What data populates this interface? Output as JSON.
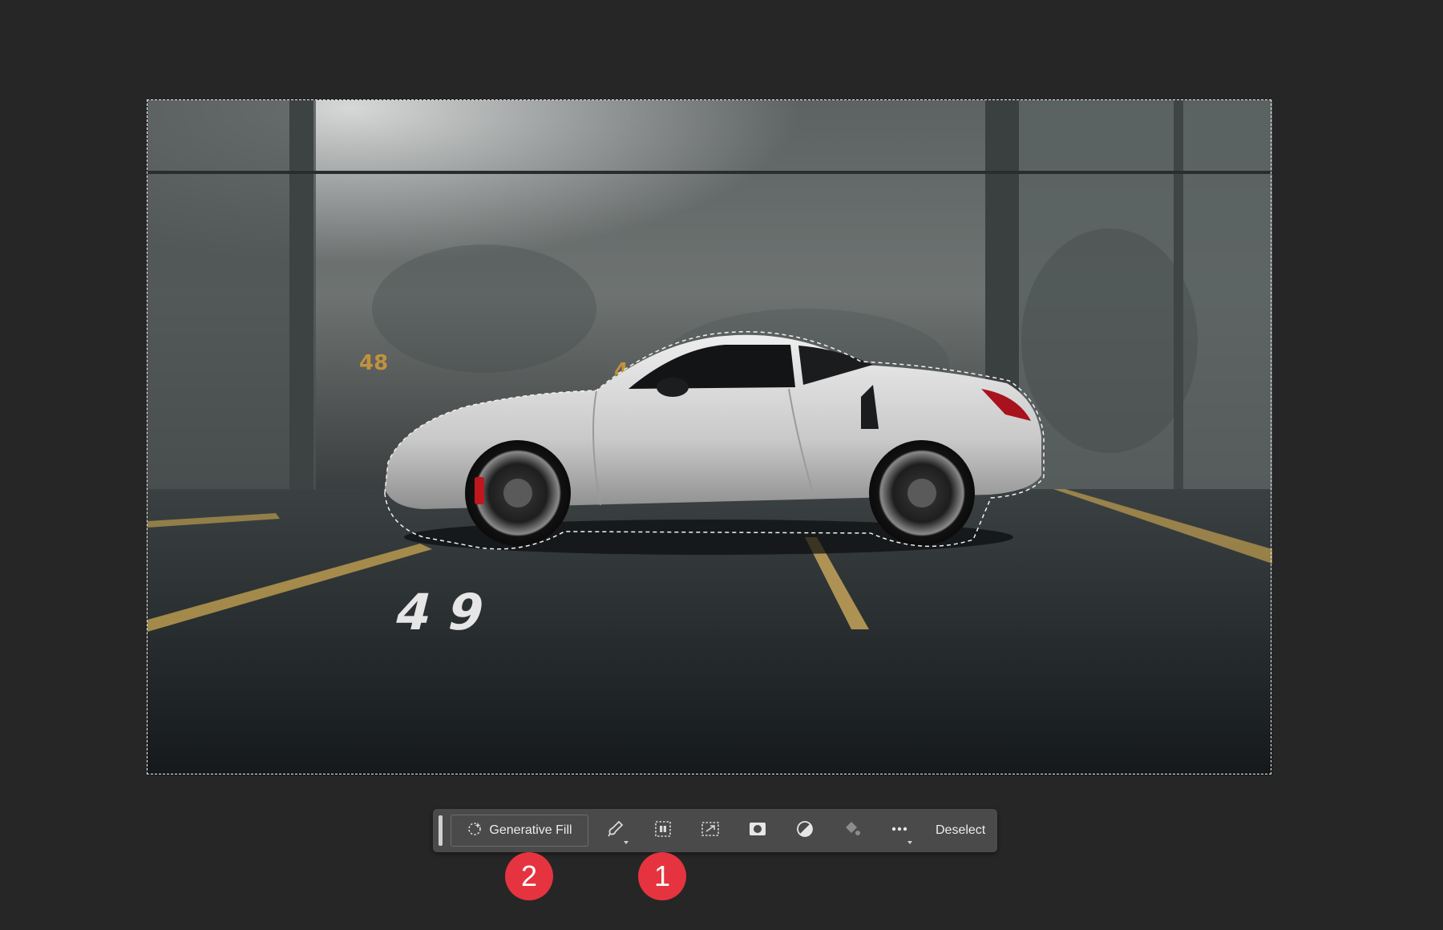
{
  "canvas": {
    "photo_subject": "car-photo",
    "wall_numbers": [
      "48",
      "4"
    ],
    "floor_numbers": [
      "9",
      "49"
    ]
  },
  "taskbar": {
    "generative_fill_label": "Generative Fill",
    "tools": [
      {
        "name": "modify-selection-icon"
      },
      {
        "name": "invert-selection-icon"
      },
      {
        "name": "transform-selection-icon"
      },
      {
        "name": "mask-icon"
      },
      {
        "name": "adjustment-icon"
      },
      {
        "name": "fill-icon"
      },
      {
        "name": "more-icon"
      }
    ],
    "deselect_label": "Deselect"
  },
  "steps": [
    {
      "label": "2"
    },
    {
      "label": "1"
    }
  ],
  "colors": {
    "background": "#262626",
    "taskbar": "#4a4a4a",
    "step_badge": "#e5343f"
  }
}
